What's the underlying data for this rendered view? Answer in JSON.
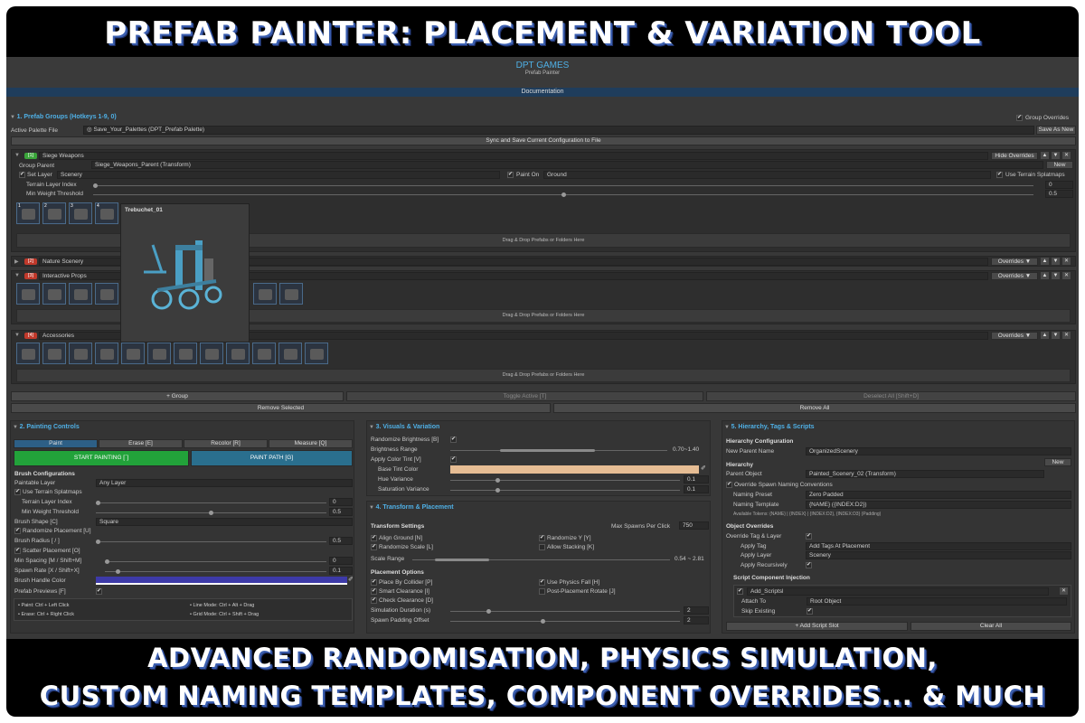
{
  "banner_top": "PREFAB PAINTER: PLACEMENT & VARIATION TOOL",
  "banner_bottom_1": "ADVANCED RANDOMISATION, PHYSICS SIMULATION,",
  "banner_bottom_2": "CUSTOM NAMING TEMPLATES, COMPONENT OVERRIDES... & MUCH MORE.",
  "header": {
    "brand": "DPT GAMES",
    "subtitle": "Prefab Painter",
    "documentation": "Documentation"
  },
  "groups_section": {
    "title": "1. Prefab Groups (Hotkeys 1-9, 0)",
    "group_overrides": "Group Overrides",
    "active_palette_label": "Active Palette File",
    "active_palette_value": "Save_Your_Palettes (DPT_Prefab Palette)",
    "save_as_new": "Save As New",
    "sync_button": "Sync and Save Current Configuration to File",
    "drag_drop": "Drag & Drop Prefabs or Folders Here",
    "add_group": "+ Group",
    "toggle_active": "Toggle Active [T]",
    "deselect_all": "Deselect All [Shift+D]",
    "remove_selected": "Remove Selected",
    "remove_all": "Remove All",
    "groups": [
      {
        "index": "[1]",
        "name": "Siege Weapons",
        "override_label": "Hide Overrides",
        "color": "#3aa53a"
      },
      {
        "index": "[2]",
        "name": "Nature Scenery",
        "override_label": "Overrides ▼",
        "color": "#c0392b"
      },
      {
        "index": "[3]",
        "name": "Interactive Props",
        "override_label": "Overrides ▼",
        "color": "#c0392b"
      },
      {
        "index": "[4]",
        "name": "Accessories",
        "override_label": "Overrides ▼",
        "color": "#c0392b"
      }
    ],
    "siege": {
      "group_parent_label": "Group Parent",
      "group_parent_value": "Siege_Weapons_Parent (Transform)",
      "new_button": "New",
      "set_layer": "Set Layer",
      "layer_value": "Scenery",
      "paint_on": "Paint On",
      "paint_on_value": "Ground",
      "use_terrain_splatmaps": "Use Terrain Splatmaps",
      "terrain_layer_index": "Terrain Layer Index",
      "terrain_layer_value": "0",
      "min_weight": "Min Weight Threshold",
      "min_weight_value": "0.5",
      "thumb_numbers": [
        "1",
        "2",
        "3",
        "4"
      ]
    },
    "tooltip_title": "Trebuchet_01"
  },
  "painting": {
    "title": "2. Painting Controls",
    "tabs": [
      "Paint",
      "Erase [E]",
      "Recolor [R]",
      "Measure [Q]"
    ],
    "start_painting": "START PAINTING [`]",
    "paint_path": "PAINT PATH [G]",
    "brush_config": "Brush Configurations",
    "paintable_layer": "Paintable Layer",
    "paintable_layer_value": "Any Layer",
    "use_terrain": "Use Terrain Splatmaps",
    "terrain_index": "Terrain Layer Index",
    "terrain_index_value": "0",
    "min_weight": "Min Weight Threshold",
    "min_weight_value": "0.5",
    "brush_shape": "Brush Shape [C]",
    "brush_shape_value": "Square",
    "randomize_placement": "Randomize Placement [U]",
    "brush_radius": "Brush Radius [ / ]",
    "brush_radius_value": "0.5",
    "scatter": "Scatter Placement [O]",
    "min_spacing": "Min Spacing [M / Shift+M]",
    "min_spacing_value": "0",
    "spawn_rate": "Spawn Rate [X / Shift+X]",
    "spawn_rate_value": "0.1",
    "handle_color": "Brush Handle Color",
    "prefab_previews": "Prefab Previews [F]",
    "hints": [
      "• Paint: Ctrl + Left Click",
      "• Line Mode: Ctrl + Alt + Drag",
      "• Erase: Ctrl + Right Click",
      "• Grid Mode: Ctrl + Shift + Drag"
    ]
  },
  "visuals": {
    "title": "3. Visuals & Variation",
    "randomize_brightness": "Randomize Brightness [B]",
    "brightness_range": "Brightness Range",
    "brightness_range_value": "0.70~1.40",
    "apply_color_tint": "Apply Color Tint [V]",
    "base_tint": "Base Tint Color",
    "hue_variance": "Hue Variance",
    "hue_variance_value": "0.1",
    "saturation_variance": "Saturation Variance",
    "saturation_variance_value": "0.1"
  },
  "transform": {
    "title": "4. Transform & Placement",
    "settings": "Transform Settings",
    "max_spawns": "Max Spawns Per Click",
    "max_spawns_value": "750",
    "align_ground": "Align Ground [N]",
    "randomize_y": "Randomize Y [Y]",
    "randomize_scale": "Randomize Scale [L]",
    "allow_stacking": "Allow Stacking [K]",
    "scale_range": "Scale Range",
    "scale_range_value": "0.54 ~ 2.81",
    "placement_options": "Placement Options",
    "place_by_collider": "Place By Collider [P]",
    "use_physics_fall": "Use Physics Fall [H]",
    "smart_clearance": "Smart Clearance [I]",
    "post_placement_rotate": "Post-Placement Rotate [J]",
    "check_clearance": "Check Clearance [D]",
    "sim_duration": "Simulation Duration (s)",
    "sim_duration_value": "2",
    "spawn_padding": "Spawn Padding Offset",
    "spawn_padding_value": "2"
  },
  "hierarchy": {
    "title": "5. Hierarchy, Tags & Scripts",
    "hier_config": "Hierarchy Configuration",
    "new_parent_name": "New Parent Name",
    "new_parent_value": "OrganizedScenery",
    "hierarchy": "Hierarchy",
    "new_button": "New",
    "parent_object": "Parent Object",
    "parent_object_value": "Painted_Scenery_02 (Transform)",
    "override_naming": "Override Spawn Naming Conventions",
    "naming_preset": "Naming Preset",
    "naming_preset_value": "Zero Padded",
    "naming_template": "Naming Template",
    "naming_template_value": "{NAME} ({INDEX:D2})",
    "tokens": "Available Tokens: {NAME}  |  {INDEX}  |  {INDEX:D2}, {INDEX:D3} (Padding)",
    "object_overrides": "Object Overrides",
    "override_tag_layer": "Override Tag & Layer",
    "apply_tag": "Apply Tag",
    "apply_tag_value": "Add Tags At Placement",
    "apply_layer": "Apply Layer",
    "apply_layer_value": "Scenery",
    "apply_recursively": "Apply Recursively",
    "script_injection": "Script Component Injection",
    "script_value": "Add_Scriptsl",
    "attach_to": "Attach To",
    "attach_to_value": "Root Object",
    "skip_existing": "Skip Existing",
    "add_script_slot": "+ Add Script Slot",
    "clear_all": "Clear All"
  },
  "colors": {
    "accent": "#4fb0e6",
    "paint_green": "#22a23a",
    "paint_blue": "#2a6f8e",
    "tint": "#e6bd94",
    "handle": "#3d3aa8"
  }
}
